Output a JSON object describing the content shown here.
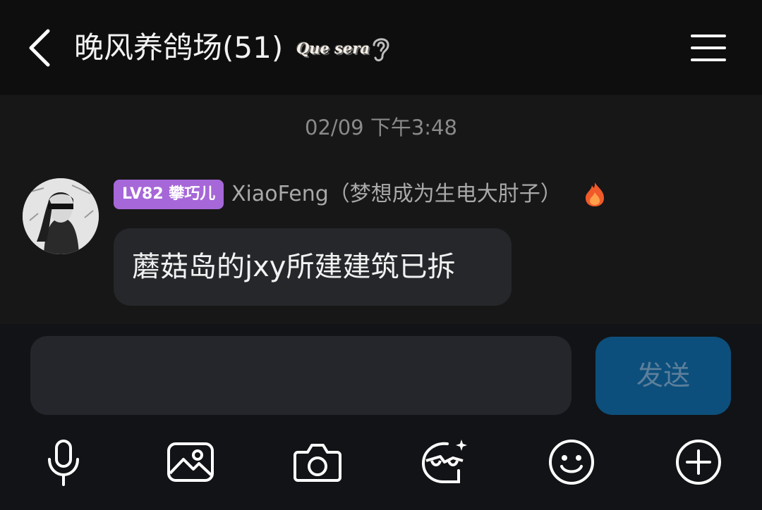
{
  "header": {
    "title": "晚风养鸽场(51)",
    "logo_text": "Que sera",
    "icons": [
      "back-icon",
      "ear-icon",
      "menu-icon"
    ]
  },
  "chat": {
    "timestamp": "02/09 下午3:48",
    "messages": [
      {
        "level_tag": "LV82 攀巧儿",
        "sender": "XiaoFeng（梦想成为生电大肘子）",
        "text": "蘑菇岛的jxy所建建筑已拆",
        "icons": [
          "avatar",
          "fire-icon"
        ]
      }
    ]
  },
  "composer": {
    "input_value": "",
    "input_placeholder": "",
    "send_label": "发送",
    "toolbar_icons": [
      "microphone-icon",
      "image-icon",
      "camera-icon",
      "sticker-icon",
      "emoji-icon",
      "plus-icon"
    ]
  },
  "colors": {
    "background": "#171717",
    "header_bg": "#0e0e0e",
    "level_tag": "#a667d8",
    "send_button": "#0d4f7c",
    "bubble": "#25272b"
  }
}
